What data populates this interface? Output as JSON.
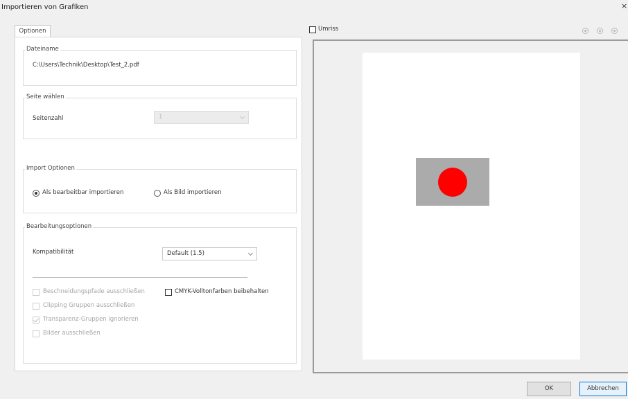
{
  "window": {
    "title": "Importieren von Grafiken",
    "close_glyph": "×"
  },
  "tabs": [
    {
      "label": "Optionen",
      "selected": true
    }
  ],
  "file_group": {
    "legend": "Dateiname",
    "path": "C:\\Users\\Technik\\Desktop\\Test_2.pdf"
  },
  "page_group": {
    "legend": "Seite wählen",
    "page_count_label": "Seitenzahl",
    "page_select": {
      "value": "1",
      "enabled": false
    }
  },
  "import_group": {
    "legend": "Import Optionen",
    "options": [
      {
        "label": "Als bearbeitbar importieren",
        "selected": true
      },
      {
        "label": "Als Bild importieren",
        "selected": false
      }
    ]
  },
  "edit_group": {
    "legend": "Bearbeitungsoptionen",
    "compat_label": "Kompatibilität",
    "compat_select": {
      "value": "Default (1.5)"
    },
    "checkboxes_left": [
      {
        "label": "Beschneidungspfade ausschließen",
        "checked": false,
        "enabled": false
      },
      {
        "label": "Clipping Gruppen ausschließen",
        "checked": false,
        "enabled": false
      },
      {
        "label": "Transparenz-Gruppen ignorieren",
        "checked": true,
        "enabled": false
      },
      {
        "label": "Bilder ausschließen",
        "checked": false,
        "enabled": false
      }
    ],
    "checkbox_right": {
      "label": "CMYK-Volltonfarben beibehalten",
      "checked": false,
      "enabled": true
    }
  },
  "preview": {
    "outline_label": "Umriss",
    "outline_checked": false,
    "icons": [
      "zoom-in-icon",
      "zoom-out-icon",
      "zoom-fit-icon"
    ],
    "colors": {
      "graphic_rect": "#ababab",
      "graphic_circle": "#ff0000",
      "page": "#ffffff"
    }
  },
  "buttons": {
    "ok": "OK",
    "cancel": "Abbrechen"
  }
}
